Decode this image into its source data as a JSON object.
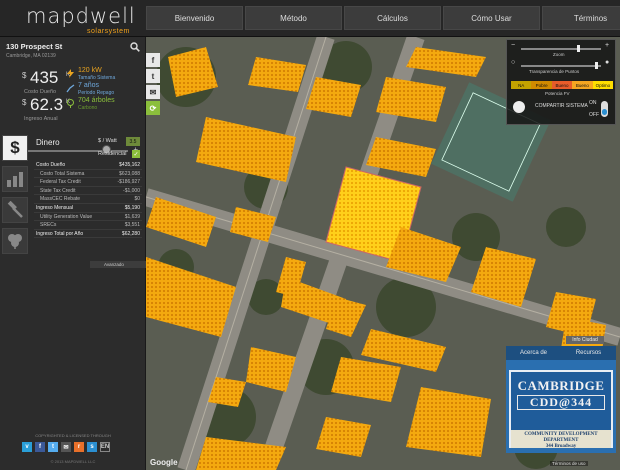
{
  "app": {
    "logo": "mapdwell",
    "logo_sub": "solarsystem"
  },
  "nav": [
    "Bienvenido",
    "Método",
    "Cálculos",
    "Cómo Usar",
    "Términos"
  ],
  "location": {
    "address": "130 Prospect St",
    "city": "Cambridge, MA 02139"
  },
  "summary": {
    "cost": {
      "currency": "$",
      "value": "435",
      "unit": "K",
      "label": "Costo Dueño"
    },
    "income": {
      "currency": "$",
      "value": "62.3",
      "unit": "K",
      "label": "Ingreso Anual"
    },
    "system": {
      "value": "120 kW",
      "label": "Tamaño Sistema"
    },
    "payback": {
      "value": "7 años",
      "label": "Periodo Repago"
    },
    "trees": {
      "value": "704 árboles",
      "label": "Carbono"
    }
  },
  "panel": {
    "title": "Dinero",
    "watt_label": "$ / Watt",
    "watt_value": "3.5",
    "residential_label": "Residencial",
    "residential_check": "✓",
    "rows": [
      {
        "k": "Costo Dueño",
        "v": "$435,162",
        "head": true
      },
      {
        "k": "Costo Total Sistema",
        "v": "$623,088"
      },
      {
        "k": "Federal Tax Credit",
        "v": "-$186,927"
      },
      {
        "k": "State Tax Credit",
        "v": "-$1,000"
      },
      {
        "k": "MassCEC Rebate",
        "v": "$0"
      },
      {
        "k": "Ingreso Mensual",
        "v": "$5,190",
        "head": true
      },
      {
        "k": "Utility Generation Value",
        "v": "$1,639"
      },
      {
        "k": "SRECs",
        "v": "$3,551"
      },
      {
        "k": "Ingreso Total por Año",
        "v": "$62,280",
        "head": true
      }
    ],
    "advanced": "Avanzado"
  },
  "footer": {
    "copyright": "COPYRIGHTED & LICENSED THROUGH",
    "copy2": "© 2013 MAPDWELL LLC"
  },
  "layers": {
    "zoom": "Zoom",
    "transparency": "Transparencia de Puntos",
    "legend": [
      "NA",
      "Pobre",
      "Bueno",
      "Bueno",
      "Optimo"
    ],
    "legend_colors": [
      "#c4a300",
      "#d08a00",
      "#e85c2a",
      "#f6a621",
      "#ffde00"
    ],
    "potential": "Potencia FV",
    "share_label": "COMPARTIR SISTEMA",
    "on": "ON",
    "off": "OFF"
  },
  "info_btn": "Info Ciudad",
  "cdd": {
    "btn1": "Acerca de",
    "btn2": "Recursos",
    "line1": "CAMBRIDGE",
    "line2": "CDD@344",
    "line3": "COMMUNITY DEVELOPMENT DEPARTMENT",
    "line4": "344 Broadway"
  },
  "map": {
    "google": "Google",
    "terms": "Términos de uso"
  }
}
